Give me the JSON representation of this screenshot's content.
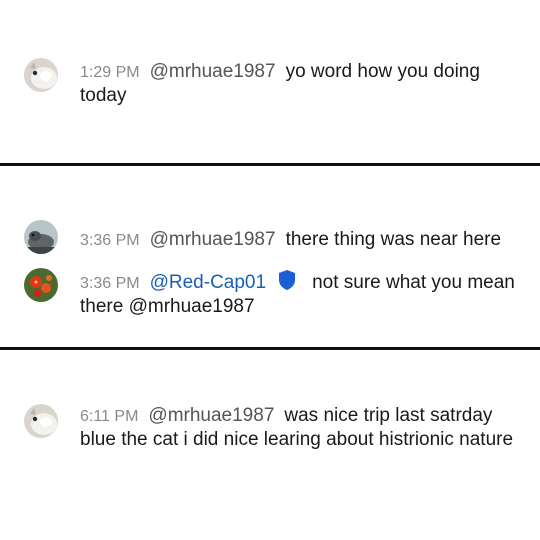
{
  "messages": [
    {
      "time": "1:29 PM",
      "username": "@mrhuae1987",
      "text": "yo word how you doing today",
      "avatar": "white-cat-avatar"
    },
    {
      "time": "3:36 PM",
      "username": "@mrhuae1987",
      "text": "there thing was near here",
      "avatar": "gray-bird-avatar"
    },
    {
      "time": "3:36 PM",
      "username": "@Red-Cap01",
      "text": "not sure what you mean there @mrhuae1987",
      "avatar": "red-flowers-avatar",
      "badge": "shield-icon"
    },
    {
      "time": "6:11 PM",
      "username": "@mrhuae1987",
      "text": "was nice trip last satrday blue the cat i did nice learing about histrionic nature",
      "avatar": "white-cat-avatar"
    }
  ],
  "colors": {
    "timestamp": "#8a8a8a",
    "username": "#555555",
    "moderator_username": "#1a5fb4",
    "divider": "#111111"
  }
}
